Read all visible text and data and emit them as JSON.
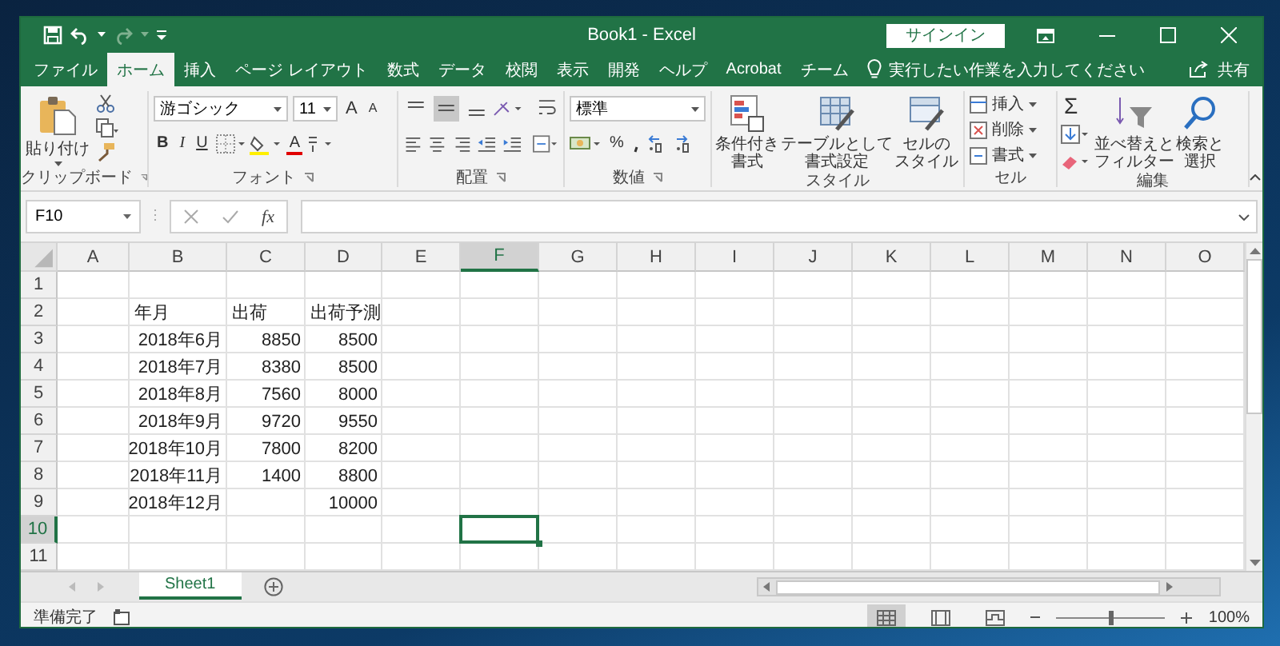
{
  "window": {
    "title": "Book1 - Excel",
    "sign_in": "サインイン"
  },
  "tabs": [
    {
      "label": "ファイル",
      "selected": false
    },
    {
      "label": "ホーム",
      "selected": true
    },
    {
      "label": "挿入",
      "selected": false
    },
    {
      "label": "ページ レイアウト",
      "selected": false
    },
    {
      "label": "数式",
      "selected": false
    },
    {
      "label": "データ",
      "selected": false
    },
    {
      "label": "校閲",
      "selected": false
    },
    {
      "label": "表示",
      "selected": false
    },
    {
      "label": "開発",
      "selected": false
    },
    {
      "label": "ヘルプ",
      "selected": false
    },
    {
      "label": "Acrobat",
      "selected": false
    },
    {
      "label": "チーム",
      "selected": false
    }
  ],
  "tell_me": "実行したい作業を入力してください",
  "share": "共有",
  "ribbon": {
    "clipboard": {
      "paste": "貼り付け",
      "label": "クリップボード"
    },
    "font": {
      "name": "游ゴシック",
      "size": "11",
      "grow": "A",
      "shrink": "A",
      "bold": "B",
      "italic": "I",
      "underline": "U",
      "color_letter": "A",
      "label": "フォント"
    },
    "alignment": {
      "vertical": [
        {
          "selected": false
        },
        {
          "selected": true
        },
        {
          "selected": false
        }
      ],
      "label": "配置"
    },
    "number": {
      "format": "標準",
      "percent": "%",
      "label": "数値"
    },
    "styles": {
      "buttons": [
        {
          "lines": [
            "条件付き",
            "書式"
          ]
        },
        {
          "lines": [
            "テーブルとして",
            "書式設定"
          ]
        },
        {
          "lines": [
            "セルの",
            "スタイル"
          ]
        }
      ],
      "label": "スタイル"
    },
    "cells": {
      "buttons": [
        "挿入",
        "削除",
        "書式"
      ],
      "label": "セル"
    },
    "editing": {
      "autosum": "Σ",
      "buttons": [
        {
          "lines": [
            "並べ替えと",
            "フィルター"
          ]
        },
        {
          "lines": [
            "検索と",
            "選択"
          ]
        }
      ],
      "label": "編集"
    }
  },
  "formula_bar": {
    "name_box": "F10",
    "function_symbol": "fx"
  },
  "sheet": {
    "columns": [
      {
        "label": "A",
        "selected": false
      },
      {
        "label": "B",
        "selected": false
      },
      {
        "label": "C",
        "selected": false
      },
      {
        "label": "D",
        "selected": false
      },
      {
        "label": "E",
        "selected": false
      },
      {
        "label": "F",
        "selected": true
      },
      {
        "label": "G",
        "selected": false
      },
      {
        "label": "H",
        "selected": false
      },
      {
        "label": "I",
        "selected": false
      },
      {
        "label": "J",
        "selected": false
      },
      {
        "label": "K",
        "selected": false
      },
      {
        "label": "L",
        "selected": false
      },
      {
        "label": "M",
        "selected": false
      },
      {
        "label": "N",
        "selected": false
      },
      {
        "label": "O",
        "selected": false
      }
    ],
    "rows": [
      {
        "label": "1",
        "selected": false
      },
      {
        "label": "2",
        "selected": false,
        "cells": [
          null,
          {
            "text": "年月",
            "kind": "text"
          },
          {
            "text": "出荷",
            "kind": "text"
          },
          {
            "text": "出荷予測",
            "kind": "text"
          }
        ]
      },
      {
        "label": "3",
        "selected": false,
        "cells": [
          null,
          {
            "text": "2018年6月",
            "kind": "number"
          },
          {
            "text": "8850",
            "kind": "number"
          },
          {
            "text": "8500",
            "kind": "number"
          }
        ]
      },
      {
        "label": "4",
        "selected": false,
        "cells": [
          null,
          {
            "text": "2018年7月",
            "kind": "number"
          },
          {
            "text": "8380",
            "kind": "number"
          },
          {
            "text": "8500",
            "kind": "number"
          }
        ]
      },
      {
        "label": "5",
        "selected": false,
        "cells": [
          null,
          {
            "text": "2018年8月",
            "kind": "number"
          },
          {
            "text": "7560",
            "kind": "number"
          },
          {
            "text": "8000",
            "kind": "number"
          }
        ]
      },
      {
        "label": "6",
        "selected": false,
        "cells": [
          null,
          {
            "text": "2018年9月",
            "kind": "number"
          },
          {
            "text": "9720",
            "kind": "number"
          },
          {
            "text": "9550",
            "kind": "number"
          }
        ]
      },
      {
        "label": "7",
        "selected": false,
        "cells": [
          null,
          {
            "text": "2018年10月",
            "kind": "number"
          },
          {
            "text": "7800",
            "kind": "number"
          },
          {
            "text": "8200",
            "kind": "number"
          }
        ]
      },
      {
        "label": "8",
        "selected": false,
        "cells": [
          null,
          {
            "text": "2018年11月",
            "kind": "number"
          },
          {
            "text": "1400",
            "kind": "number"
          },
          {
            "text": "8800",
            "kind": "number"
          }
        ]
      },
      {
        "label": "9",
        "selected": false,
        "cells": [
          null,
          {
            "text": "2018年12月",
            "kind": "number"
          },
          null,
          {
            "text": "10000",
            "kind": "number"
          }
        ]
      },
      {
        "label": "10",
        "selected": true
      },
      {
        "label": "11",
        "selected": false
      }
    ]
  },
  "sheet_tabs": [
    {
      "label": "Sheet1",
      "selected": true
    }
  ],
  "status_bar": {
    "text": "準備完了",
    "views": [
      {
        "selected": true
      },
      {
        "selected": false
      },
      {
        "selected": false
      }
    ],
    "zoom": {
      "level": 0.5,
      "reading": "100%"
    }
  }
}
